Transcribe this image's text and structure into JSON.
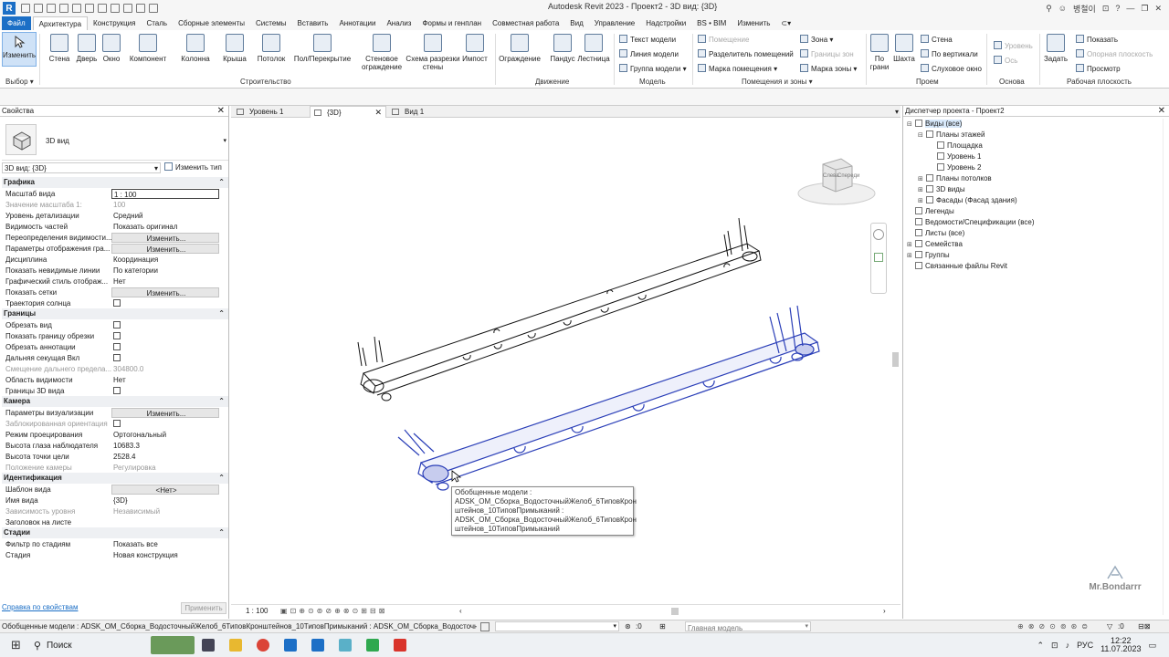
{
  "window": {
    "title": "Autodesk Revit 2023 - Проект2 - 3D вид: {3D}",
    "user": "병철이"
  },
  "menu_tabs": [
    "Файл",
    "Архитектура",
    "Конструкция",
    "Сталь",
    "Сборные элементы",
    "Системы",
    "Вставить",
    "Аннотации",
    "Анализ",
    "Формы и генплан",
    "Совместная работа",
    "Вид",
    "Управление",
    "Надстройки",
    "BS • BIM",
    "Изменить"
  ],
  "ribbon": {
    "select": {
      "label": "Изменить",
      "group": "Выбор ▾"
    },
    "build": {
      "items": [
        "Стена",
        "Дверь",
        "Окно",
        "Компонент",
        "Колонна",
        "Крыша",
        "Потолок",
        "Пол/Перекрытие",
        "Стеновое ограждение",
        "Схема разрезки стены",
        "Импост"
      ],
      "group": "Строительство"
    },
    "circulation": {
      "items": [
        "Ограждение",
        "Пандус",
        "Лестница"
      ],
      "group": "Движение"
    },
    "model": {
      "items": [
        "Текст модели",
        "Линия модели",
        "Группа модели ▾"
      ],
      "group": "Модель"
    },
    "room": {
      "items": [
        "Помещение",
        "Разделитель помещений",
        "Марка помещения ▾",
        "Зона ▾",
        "Границы зон",
        "Марка зоны ▾"
      ],
      "group": "Помещения и зоны ▾"
    },
    "opening": {
      "items": [
        "По грани",
        "Шахта",
        "Стена",
        "По вертикали",
        "Слуховое окно"
      ],
      "group": "Проем"
    },
    "datum": {
      "items": [
        "Уровень",
        "Ось"
      ],
      "group": "Основа"
    },
    "workplane": {
      "items": [
        "Задать",
        "Показать",
        "Опорная плоскость",
        "Просмотр"
      ],
      "group": "Рабочая плоскость"
    }
  },
  "properties": {
    "title": "Свойства",
    "type_name": "3D вид",
    "selector": "3D вид: {3D}",
    "edit_type": "Изменить тип",
    "sections": [
      {
        "name": "Графика",
        "rows": [
          {
            "k": "Масштаб вида",
            "v": "1 : 100",
            "style": "box"
          },
          {
            "k": "Значение масштаба    1:",
            "v": "100",
            "dis": true
          },
          {
            "k": "Уровень детализации",
            "v": "Средний"
          },
          {
            "k": "Видимость частей",
            "v": "Показать оригинал"
          },
          {
            "k": "Переопределения видимости...",
            "v": "Изменить...",
            "style": "btn"
          },
          {
            "k": "Параметры отображения гра...",
            "v": "Изменить...",
            "style": "btn"
          },
          {
            "k": "Дисциплина",
            "v": "Координация"
          },
          {
            "k": "Показать невидимые линии",
            "v": "По категории"
          },
          {
            "k": "Графический стиль отображ...",
            "v": "Нет"
          },
          {
            "k": "Показать сетки",
            "v": "Изменить...",
            "style": "btn"
          },
          {
            "k": "Траектория солнца",
            "v": "",
            "style": "cb"
          }
        ]
      },
      {
        "name": "Границы",
        "rows": [
          {
            "k": "Обрезать вид",
            "v": "",
            "style": "cb"
          },
          {
            "k": "Показать границу обрезки",
            "v": "",
            "style": "cb"
          },
          {
            "k": "Обрезать аннотации",
            "v": "",
            "style": "cb"
          },
          {
            "k": "Дальняя секущая Вкл",
            "v": "",
            "style": "cb"
          },
          {
            "k": "Смещение дальнего предела...",
            "v": "304800.0",
            "dis": true
          },
          {
            "k": "Область видимости",
            "v": "Нет"
          },
          {
            "k": "Границы 3D вида",
            "v": "",
            "style": "cb"
          }
        ]
      },
      {
        "name": "Камера",
        "rows": [
          {
            "k": "Параметры визуализации",
            "v": "Изменить...",
            "style": "btn"
          },
          {
            "k": "Заблокированная ориентация",
            "v": "",
            "style": "cb",
            "dis": true
          },
          {
            "k": "Режим проецирования",
            "v": "Ортогональный"
          },
          {
            "k": "Высота глаза наблюдателя",
            "v": "10683.3"
          },
          {
            "k": "Высота точки цели",
            "v": "2528.4"
          },
          {
            "k": "Положение камеры",
            "v": "Регулировка",
            "dis": true
          }
        ]
      },
      {
        "name": "Идентификация",
        "rows": [
          {
            "k": "Шаблон вида",
            "v": "<Нет>",
            "style": "btn"
          },
          {
            "k": "Имя вида",
            "v": "{3D}"
          },
          {
            "k": "Зависимость уровня",
            "v": "Независимый",
            "dis": true
          },
          {
            "k": "Заголовок на листе",
            "v": ""
          }
        ]
      },
      {
        "name": "Стадии",
        "rows": [
          {
            "k": "Фильтр по стадиям",
            "v": "Показать все"
          },
          {
            "k": "Стадия",
            "v": "Новая конструкция"
          }
        ]
      }
    ],
    "help_link": "Справка по свойствам",
    "apply": "Применить"
  },
  "view_tabs": [
    {
      "label": "Уровень 1"
    },
    {
      "label": "{3D}"
    },
    {
      "label": "Вид 1"
    }
  ],
  "viewcube": {
    "face1": "Слева",
    "face2": "Спереди"
  },
  "tooltip": {
    "lines": [
      "Обобщенные модели :",
      "ADSK_ОМ_Сборка_ВодосточныйЖелоб_6ТиповКрон",
      "штейнов_10ТиповПримыканий :",
      "ADSK_ОМ_Сборка_ВодосточныйЖелоб_6ТиповКрон",
      "штейнов_10ТиповПримыканий"
    ]
  },
  "view_scale": "1 : 100",
  "browser": {
    "title": "Диспетчер проекта - Проект2",
    "nodes": [
      {
        "label": "Виды (все)",
        "lvl": 0,
        "exp": "⊟"
      },
      {
        "label": "Планы этажей",
        "lvl": 1,
        "exp": "⊟"
      },
      {
        "label": "Площадка",
        "lvl": 2,
        "exp": ""
      },
      {
        "label": "Уровень 1",
        "lvl": 2,
        "exp": ""
      },
      {
        "label": "Уровень 2",
        "lvl": 2,
        "exp": ""
      },
      {
        "label": "Планы потолков",
        "lvl": 1,
        "exp": "⊞"
      },
      {
        "label": "3D виды",
        "lvl": 1,
        "exp": "⊞"
      },
      {
        "label": "Фасады (Фасад здания)",
        "lvl": 1,
        "exp": "⊞"
      },
      {
        "label": "Легенды",
        "lvl": 0,
        "exp": ""
      },
      {
        "label": "Ведомости/Спецификации (все)",
        "lvl": 0,
        "exp": ""
      },
      {
        "label": "Листы (все)",
        "lvl": 0,
        "exp": ""
      },
      {
        "label": "Семейства",
        "lvl": 0,
        "exp": "⊞"
      },
      {
        "label": "Группы",
        "lvl": 0,
        "exp": "⊞"
      },
      {
        "label": "Связанные файлы Revit",
        "lvl": 0,
        "exp": ""
      }
    ]
  },
  "watermark": "Mr.Bondarrr",
  "status": {
    "text": "Обобщенные модели : ADSK_ОМ_Сборка_ВодосточныйЖелоб_6ТиповКронштейнов_10ТиповПримыканий : ADSK_ОМ_Сборка_Водосточный",
    "counter": ":0",
    "model": "Главная модель",
    "sel_count": ":0"
  },
  "taskbar": {
    "search": "Поиск",
    "lang": "РУС",
    "time": "12:22",
    "date": "11.07.2023"
  },
  "colors": {
    "accent": "#1c6fc6",
    "selection": "#2b3fb8"
  }
}
